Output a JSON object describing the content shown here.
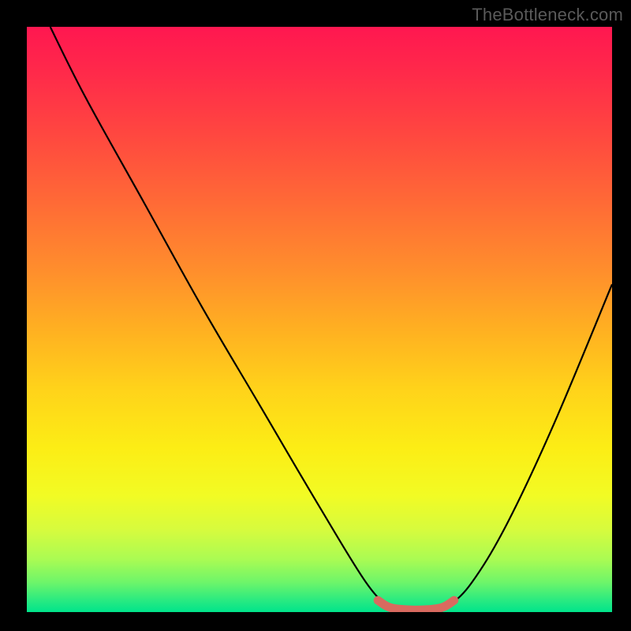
{
  "watermark": "TheBottleneck.com",
  "chart_data": {
    "type": "line",
    "title": "",
    "xlabel": "",
    "ylabel": "",
    "xlim": [
      0,
      100
    ],
    "ylim": [
      0,
      100
    ],
    "grid": false,
    "legend": false,
    "series": [
      {
        "name": "bottleneck-curve",
        "x": [
          4,
          10,
          20,
          30,
          40,
          50,
          58,
          62,
          65,
          70,
          72,
          76,
          82,
          90,
          100
        ],
        "y": [
          100,
          88,
          70,
          52,
          35,
          18,
          5,
          1,
          0,
          0,
          1,
          5,
          15,
          32,
          56
        ],
        "color": "#000000"
      },
      {
        "name": "optimal-band",
        "x": [
          60,
          62,
          65,
          68,
          71,
          73
        ],
        "y": [
          2,
          0.8,
          0.4,
          0.4,
          0.8,
          2
        ],
        "color": "#d96a5f"
      }
    ],
    "gradient_stops": [
      {
        "pos": 0.0,
        "color": "#ff1750"
      },
      {
        "pos": 0.3,
        "color": "#ff6a36"
      },
      {
        "pos": 0.62,
        "color": "#ffd31a"
      },
      {
        "pos": 0.86,
        "color": "#d6fb3e"
      },
      {
        "pos": 1.0,
        "color": "#00e48b"
      }
    ]
  }
}
